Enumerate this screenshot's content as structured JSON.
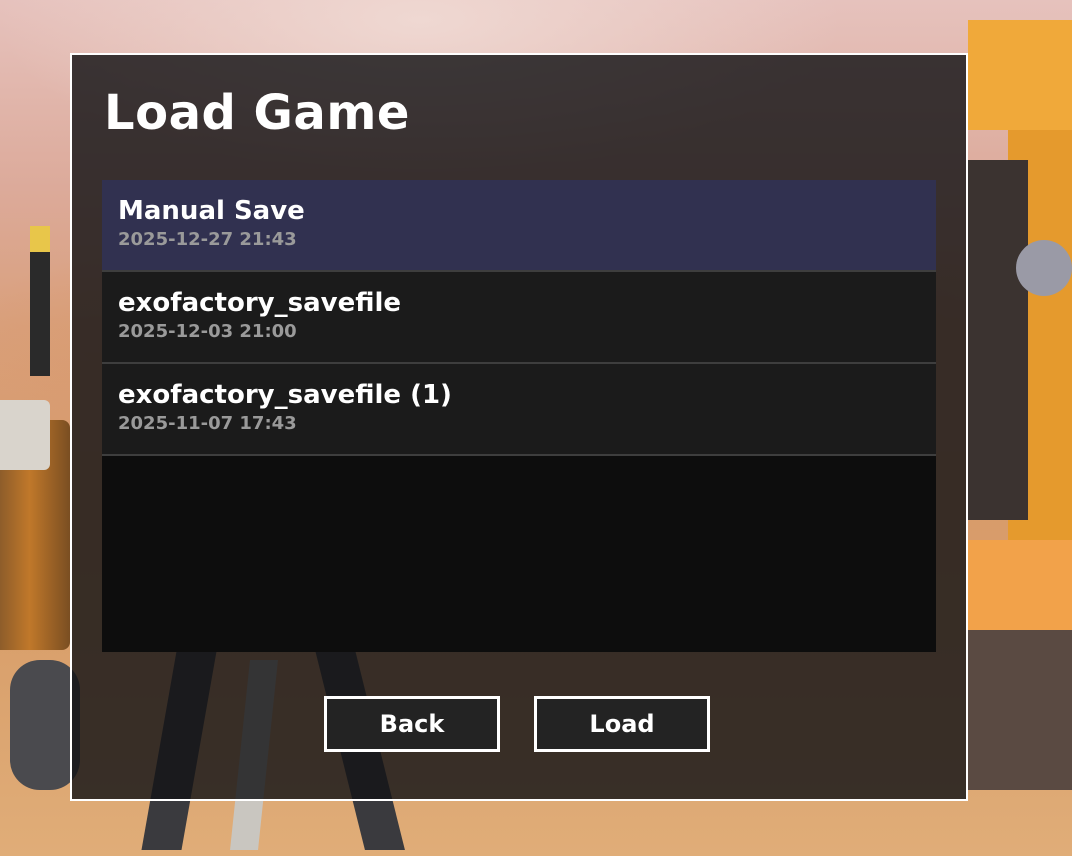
{
  "dialog": {
    "title": "Load Game"
  },
  "saves": [
    {
      "name": "Manual Save",
      "date": "2025-12-27 21:43",
      "selected": true
    },
    {
      "name": "exofactory_savefile",
      "date": "2025-12-03 21:00",
      "selected": false
    },
    {
      "name": "exofactory_savefile (1)",
      "date": "2025-11-07 17:43",
      "selected": false
    }
  ],
  "buttons": {
    "back_label": "Back",
    "load_label": "Load"
  },
  "colors": {
    "selected_row": "#313150",
    "row": "#1b1b1b",
    "list_bg": "#0d0d0d",
    "panel_border": "#ffffff",
    "date_text": "#9a9a9a"
  }
}
